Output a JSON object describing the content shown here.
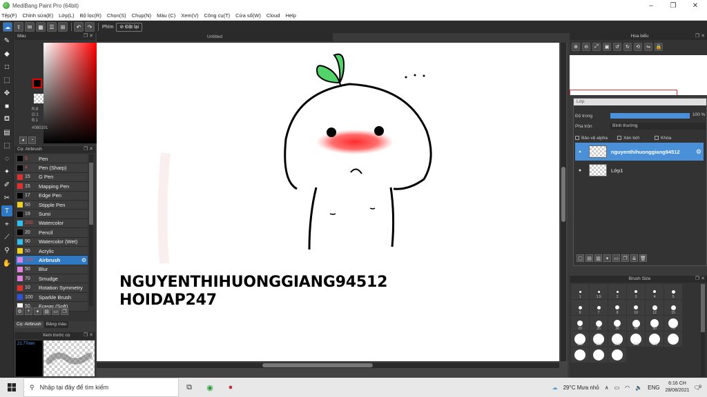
{
  "window": {
    "title": "MediBang Paint Pro (64bit)"
  },
  "menu": [
    "Tệp(F)",
    "Chỉnh sửa(E)",
    "Lớp(L)",
    "Bộ lọc(R)",
    "Chọn(S)",
    "Chụp(N)",
    "Màu (C)",
    "Xem(V)",
    "Công cụ(T)",
    "Cửa sổ(W)",
    "Cloud",
    "Help"
  ],
  "toolbar": {
    "key_label": "Phím",
    "reset_label": "Đặt lại"
  },
  "color_panel": {
    "title": "Màu",
    "r": "R:8",
    "g": "G:1",
    "b": "B:1",
    "hex": "#080101"
  },
  "brush_panel": {
    "title": "Cọ: Airbrush",
    "items": [
      {
        "size": "5",
        "name": "Pen",
        "color": "#000000",
        "hl": true
      },
      {
        "size": "4",
        "name": "Pen (Sharp)",
        "color": "#000000",
        "hl": true
      },
      {
        "size": "15",
        "name": "G Pen",
        "color": "#e03030",
        "hl": false
      },
      {
        "size": "15",
        "name": "Mapping Pen",
        "color": "#e03030",
        "hl": false
      },
      {
        "size": "17",
        "name": "Edge Pen",
        "color": "#000000",
        "hl": false
      },
      {
        "size": "50",
        "name": "Stipple Pen",
        "color": "#f0d020",
        "hl": false
      },
      {
        "size": "19",
        "name": "Sumi",
        "color": "#000000",
        "hl": false
      },
      {
        "size": "200",
        "name": "Watercolor",
        "color": "#30c0f0",
        "hl": true
      },
      {
        "size": "20",
        "name": "Pencil",
        "color": "#000000",
        "hl": false
      },
      {
        "size": "90",
        "name": "Watercolor (Wet)",
        "color": "#30c0f0",
        "hl": false
      },
      {
        "size": "50",
        "name": "Acrylic",
        "color": "#f0d020",
        "hl": false
      },
      {
        "size": "100",
        "name": "Airbrush",
        "color": "#e080e0",
        "hl": true,
        "selected": true
      },
      {
        "size": "50",
        "name": "Blur",
        "color": "#e080e0",
        "hl": false
      },
      {
        "size": "70",
        "name": "Smudge",
        "color": "#e080e0",
        "hl": false
      },
      {
        "size": "10",
        "name": "Rotation Symmetry",
        "color": "#e03030",
        "hl": false
      },
      {
        "size": "100",
        "name": "Sparkle Brush",
        "color": "#3050e0",
        "hl": false
      },
      {
        "size": "50",
        "name": "Eraser (Soft)",
        "color": "#ffffff",
        "hl": false
      }
    ],
    "tabs": [
      "Cọ: Airbrush",
      "Bảng màu"
    ]
  },
  "preview_panel": {
    "title": "Xem trước cọ",
    "size": "21.77mm"
  },
  "canvas": {
    "tab": "Untitled",
    "text_line1": "NGUYENTHIHUONGGIANG94512",
    "text_line2": "HOIDAP247"
  },
  "navigator": {
    "title": "Hoa biểu"
  },
  "layer_panel": {
    "title": "Lớp",
    "opacity_label": "Độ trong",
    "opacity_value": "100 %",
    "opacity_fraction": 1.0,
    "blend_label": "Pha trộn",
    "blend_value": "Bình thường",
    "protect_alpha": "Bảo vệ alpha",
    "clipping": "Xén bớt",
    "lock": "Khóa",
    "layers": [
      {
        "name": "nguyenthihuonggiang94512",
        "selected": true
      },
      {
        "name": "Lớp1",
        "selected": false
      }
    ]
  },
  "brush_size": {
    "title": "Brush Size",
    "sizes": [
      "1",
      "1.5",
      "2",
      "3",
      "4",
      "5",
      "6",
      "7",
      "8",
      "10",
      "12",
      "15",
      "20",
      "25",
      "30",
      "40",
      "50",
      "70",
      "100",
      "150",
      "200",
      "300",
      "400",
      "",
      "",
      "",
      ""
    ]
  },
  "taskbar": {
    "search_placeholder": "Nhập tại đây để tìm kiếm",
    "weather": "29°C  Mưa nhỏ",
    "lang": "ENG",
    "time": "6:16 CH",
    "date": "28/08/2021",
    "notif": "9"
  }
}
